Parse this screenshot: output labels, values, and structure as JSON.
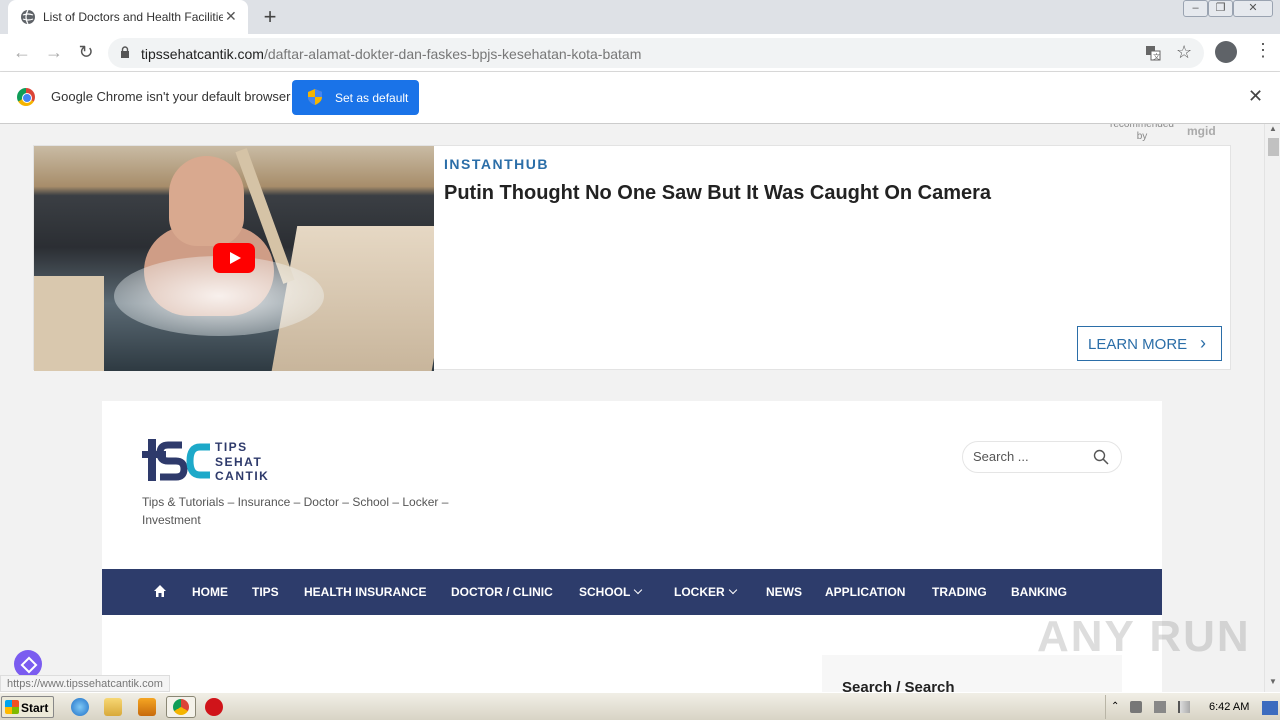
{
  "browser": {
    "tab_title": "List of Doctors and Health Facilities BPJS",
    "url_domain": "tipssehatcantik.com",
    "url_path": "/daftar-alamat-dokter-dan-faskes-bpjs-kesehatan-kota-batam"
  },
  "infobar": {
    "message": "Google Chrome isn't your default browser",
    "button": "Set as default"
  },
  "ad": {
    "recommended_by": "recommended by",
    "network": "mgid",
    "source": "INSTANTHUB",
    "headline": "Putin Thought No One Saw But It Was Caught On Camera",
    "cta": "LEARN MORE"
  },
  "site": {
    "logo_words": [
      "TIPS",
      "SEHAT",
      "CANTIK"
    ],
    "tagline": "Tips & Tutorials – Insurance – Doctor – School – Locker – Investment",
    "search_placeholder": "Search ...",
    "nav": [
      {
        "label": "HOME",
        "dropdown": false
      },
      {
        "label": "TIPS",
        "dropdown": false
      },
      {
        "label": "HEALTH INSURANCE",
        "dropdown": false
      },
      {
        "label": "DOCTOR / CLINIC",
        "dropdown": false
      },
      {
        "label": "SCHOOL",
        "dropdown": true
      },
      {
        "label": "LOCKER",
        "dropdown": true
      },
      {
        "label": "NEWS",
        "dropdown": false
      },
      {
        "label": "APPLICATION",
        "dropdown": false
      },
      {
        "label": "TRADING",
        "dropdown": false
      },
      {
        "label": "BANKING",
        "dropdown": false
      }
    ],
    "sidebar_heading": "Search / Search"
  },
  "status_url": "https://www.tipssehatcantik.com",
  "watermark": "ANY RUN",
  "taskbar": {
    "start": "Start",
    "time": "6:42 AM"
  },
  "colors": {
    "nav_bg": "#2d3c6b",
    "chrome_blue": "#1a73e8",
    "ad_accent": "#2b6ea8"
  }
}
